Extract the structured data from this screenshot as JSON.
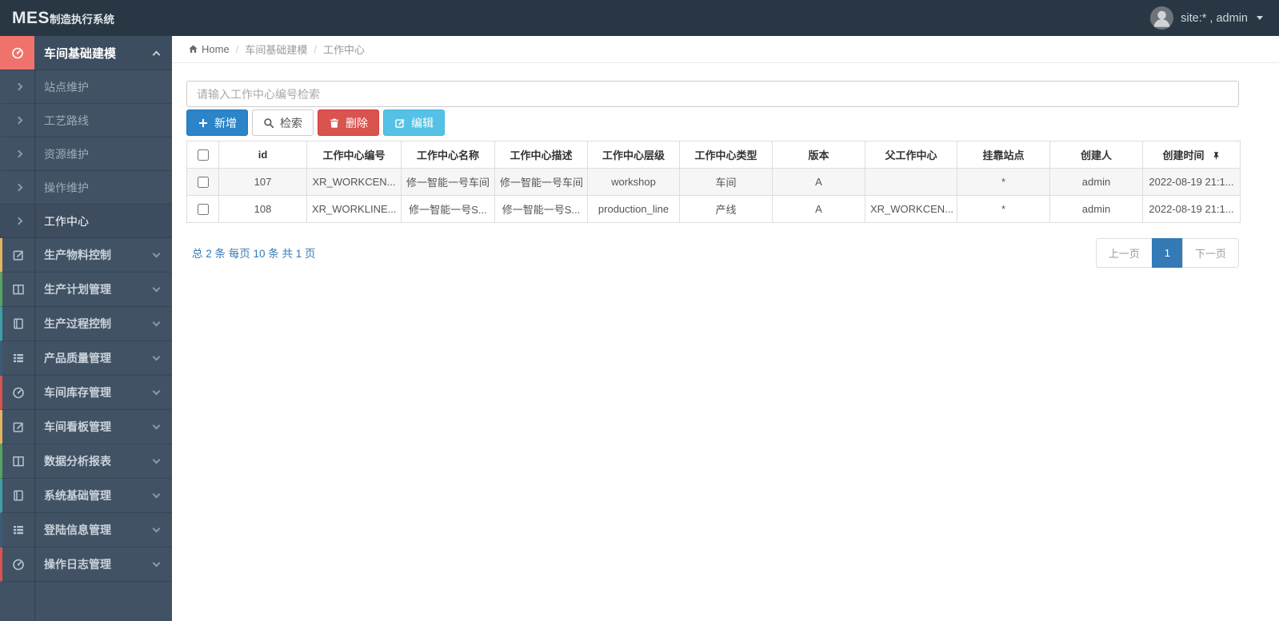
{
  "topbar": {
    "brand_primary": "MES",
    "brand_secondary": "制造执行系统",
    "user_label": "site:* , admin"
  },
  "breadcrumb": {
    "home": "Home",
    "crumbs": [
      "车间基础建模",
      "工作中心"
    ]
  },
  "sidebar": {
    "parent": {
      "label": "车间基础建模",
      "icon": "gauge",
      "icon_bg": "#f0736b"
    },
    "submenu": [
      {
        "label": "站点维护",
        "active": false
      },
      {
        "label": "工艺路线",
        "active": false
      },
      {
        "label": "资源维护",
        "active": false
      },
      {
        "label": "操作维护",
        "active": false
      },
      {
        "label": "工作中心",
        "active": true
      }
    ],
    "items": [
      {
        "label": "生产物料控制",
        "icon": "edit",
        "border": "#e3b55c"
      },
      {
        "label": "生产计划管理",
        "icon": "columns",
        "border": "#55a45f"
      },
      {
        "label": "生产过程控制",
        "icon": "book",
        "border": "#3ba0a5"
      },
      {
        "label": "产品质量管理",
        "icon": "list",
        "border": "#3d5a77"
      },
      {
        "label": "车间库存管理",
        "icon": "gauge",
        "border": "#d9534f"
      },
      {
        "label": "车间看板管理",
        "icon": "edit",
        "border": "#e3b55c"
      },
      {
        "label": "数据分析报表",
        "icon": "columns",
        "border": "#55a45f"
      },
      {
        "label": "系统基础管理",
        "icon": "book",
        "border": "#3ba0a5"
      },
      {
        "label": "登陆信息管理",
        "icon": "list",
        "border": "#3d5a77"
      },
      {
        "label": "操作日志管理",
        "icon": "gauge",
        "border": "#d9534f"
      }
    ]
  },
  "toolbar": {
    "search_placeholder": "请输入工作中心编号检索",
    "add_label": "新增",
    "query_label": "检索",
    "delete_label": "删除",
    "edit_label": "编辑"
  },
  "table": {
    "columns": [
      "id",
      "工作中心编号",
      "工作中心名称",
      "工作中心描述",
      "工作中心层级",
      "工作中心类型",
      "版本",
      "父工作中心",
      "挂靠站点",
      "创建人",
      "创建时间"
    ],
    "rows": [
      [
        "107",
        "XR_WORKCEN...",
        "修一智能一号车间",
        "修一智能一号车间",
        "workshop",
        "车间",
        "A",
        "",
        "*",
        "admin",
        "2022-08-19 21:1..."
      ],
      [
        "108",
        "XR_WORKLINE...",
        "修一智能一号S...",
        "修一智能一号S...",
        "production_line",
        "产线",
        "A",
        "XR_WORKCEN...",
        "*",
        "admin",
        "2022-08-19 21:1..."
      ]
    ]
  },
  "pagination": {
    "summary": "总 2 条  每页 10 条  共 1 页",
    "prev_label": "上一页",
    "page_label": "1",
    "next_label": "下一页"
  },
  "colors": {
    "accent_blue": "#2b85c8",
    "danger_red": "#d9534f",
    "info_blue": "#55c1e6",
    "link_blue": "#337ab7",
    "topbar_bg": "#283743",
    "sidebar_bg": "#415265"
  }
}
